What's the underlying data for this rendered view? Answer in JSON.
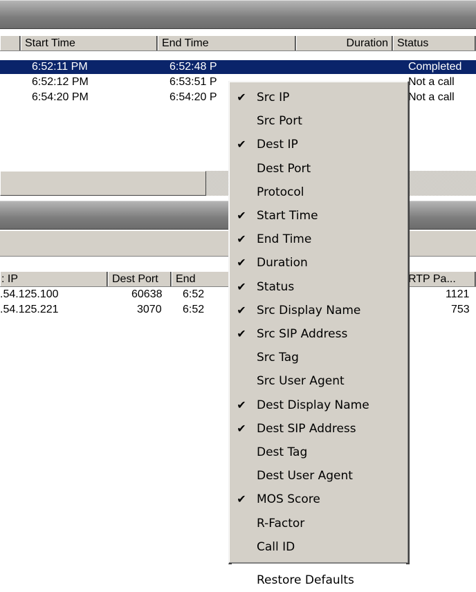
{
  "top_table": {
    "columns": [
      "",
      "Start Time",
      "End Time",
      "Duration",
      "Status"
    ],
    "rows": [
      {
        "start": "6:52:11 PM",
        "end": "6:52:48 P",
        "status": "Completed",
        "selected": true
      },
      {
        "start": "6:52:12 PM",
        "end": "6:53:51 P",
        "status": "Not a call",
        "selected": false
      },
      {
        "start": "6:54:20 PM",
        "end": "6:54:20 P",
        "status": "Not a call",
        "selected": false
      }
    ]
  },
  "bottom_table": {
    "columns": [
      ": IP",
      "Dest Port",
      "End",
      "RTP Pa..."
    ],
    "rows": [
      {
        "ip": ".54.125.100",
        "port": "60638",
        "end": "6:52",
        "rtp": "1121"
      },
      {
        "ip": ".54.125.221",
        "port": "3070",
        "end": "6:52",
        "rtp": "753"
      }
    ]
  },
  "context_menu": {
    "items": [
      {
        "label": "Src IP",
        "checked": true
      },
      {
        "label": "Src Port",
        "checked": false
      },
      {
        "label": "Dest IP",
        "checked": true
      },
      {
        "label": "Dest Port",
        "checked": false
      },
      {
        "label": "Protocol",
        "checked": false
      },
      {
        "label": "Start Time",
        "checked": true
      },
      {
        "label": "End Time",
        "checked": true
      },
      {
        "label": "Duration",
        "checked": true
      },
      {
        "label": "Status",
        "checked": true
      },
      {
        "label": "Src Display Name",
        "checked": true
      },
      {
        "label": "Src SIP Address",
        "checked": true
      },
      {
        "label": "Src Tag",
        "checked": false
      },
      {
        "label": "Src User Agent",
        "checked": false
      },
      {
        "label": "Dest Display Name",
        "checked": true
      },
      {
        "label": "Dest SIP Address",
        "checked": true
      },
      {
        "label": "Dest Tag",
        "checked": false
      },
      {
        "label": "Dest User Agent",
        "checked": false
      },
      {
        "label": "MOS Score",
        "checked": true
      },
      {
        "label": "R-Factor",
        "checked": false
      },
      {
        "label": "Call ID",
        "checked": false
      }
    ],
    "restore_label": "Restore Defaults",
    "check_glyph": "✔"
  },
  "colors": {
    "selection": "#0a246a",
    "menu_bg": "#d4d0c8"
  }
}
